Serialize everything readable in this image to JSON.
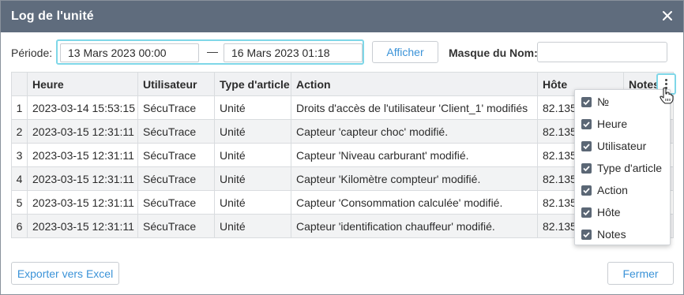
{
  "window": {
    "title": "Log de l'unité",
    "close_icon": "close-icon"
  },
  "filters": {
    "period_label": "Période:",
    "date_from": "13 Mars 2023 00:00",
    "dash": "—",
    "date_to": "16 Mars 2023 01:18",
    "show_button": "Afficher",
    "name_mask_label": "Masque du Nom:",
    "name_mask_value": ""
  },
  "table": {
    "columns": [
      "",
      "Heure",
      "Utilisateur",
      "Type d'article",
      "Action",
      "Hôte",
      "Notes"
    ],
    "rows": [
      {
        "n": "1",
        "time": "2023-03-14 15:53:15",
        "user": "SécuTrace",
        "type": "Unité",
        "action": "Droits d'accès de l'utilisateur 'Client_1' modifiés",
        "host": "82.135"
      },
      {
        "n": "2",
        "time": "2023-03-15 12:31:11",
        "user": "SécuTrace",
        "type": "Unité",
        "action": "Capteur 'capteur choc' modifié.",
        "host": "82.135"
      },
      {
        "n": "3",
        "time": "2023-03-15 12:31:11",
        "user": "SécuTrace",
        "type": "Unité",
        "action": "Capteur 'Niveau carburant' modifié.",
        "host": "82.135"
      },
      {
        "n": "4",
        "time": "2023-03-15 12:31:11",
        "user": "SécuTrace",
        "type": "Unité",
        "action": "Capteur 'Kilomètre compteur' modifié.",
        "host": "82.135"
      },
      {
        "n": "5",
        "time": "2023-03-15 12:31:11",
        "user": "SécuTrace",
        "type": "Unité",
        "action": "Capteur 'Consommation calculée' modifié.",
        "host": "82.135"
      },
      {
        "n": "6",
        "time": "2023-03-15 12:31:11",
        "user": "SécuTrace",
        "type": "Unité",
        "action": "Capteur 'identification chauffeur' modifié.",
        "host": "82.135"
      }
    ]
  },
  "column_menu": {
    "icon": "more-vertical-icon",
    "items": [
      {
        "label": "№",
        "checked": true
      },
      {
        "label": "Heure",
        "checked": true
      },
      {
        "label": "Utilisateur",
        "checked": true
      },
      {
        "label": "Type d'article",
        "checked": true
      },
      {
        "label": "Action",
        "checked": true
      },
      {
        "label": "Hôte",
        "checked": true
      },
      {
        "label": "Notes",
        "checked": true
      }
    ]
  },
  "footer": {
    "export_button": "Exporter vers Excel",
    "close_button": "Fermer"
  },
  "colors": {
    "titlebar": "#5f6c7d",
    "accent": "#3b93d8",
    "focus": "#7fd7e8",
    "checkbox": "#5b6775"
  }
}
